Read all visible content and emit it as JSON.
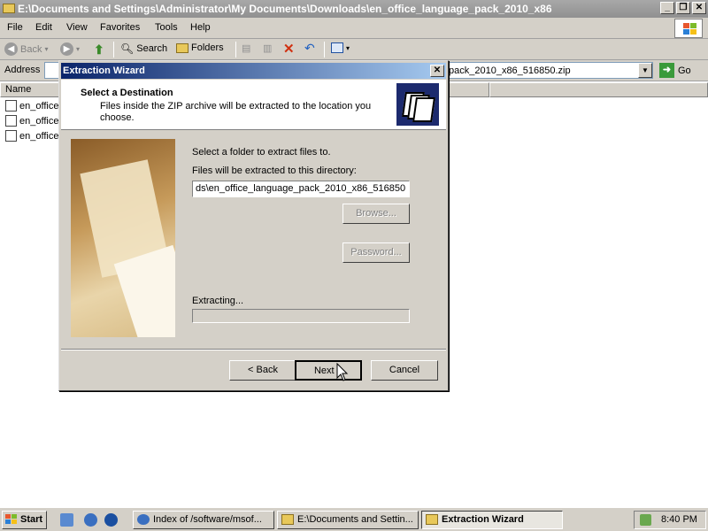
{
  "explorer": {
    "title": "E:\\Documents and Settings\\Administrator\\My Documents\\Downloads\\en_office_language_pack_2010_x86",
    "menu": [
      "File",
      "Edit",
      "View",
      "Favorites",
      "Tools",
      "Help"
    ],
    "toolbar": {
      "back": "Back",
      "search": "Search",
      "folders": "Folders"
    },
    "address": {
      "label": "Address",
      "value": "pack_2010_x86_516850.zip",
      "go": "Go"
    },
    "columns": {
      "name": "Name"
    },
    "files": [
      "en_office",
      "en_office",
      "en_office"
    ]
  },
  "wizard": {
    "title": "Extraction Wizard",
    "header_title": "Select a Destination",
    "header_subtitle": "Files inside the ZIP archive will be extracted to the location you choose.",
    "select_folder_label": "Select a folder to extract files to.",
    "directory_label": "Files will be extracted to this directory:",
    "directory_value": "ds\\en_office_language_pack_2010_x86_516850",
    "browse_label": "Browse...",
    "password_label": "Password...",
    "extracting_label": "Extracting...",
    "progress": 0,
    "back_label": "< Back",
    "next_label": "Next >",
    "cancel_label": "Cancel"
  },
  "taskbar": {
    "start": "Start",
    "tasks": [
      {
        "label": "Index of /software/msof...",
        "icon": "ie-icon"
      },
      {
        "label": "E:\\Documents and Settin...",
        "icon": "folder-icon"
      },
      {
        "label": "Extraction Wizard",
        "icon": "folder-icon"
      }
    ],
    "time": "8:40 PM"
  }
}
